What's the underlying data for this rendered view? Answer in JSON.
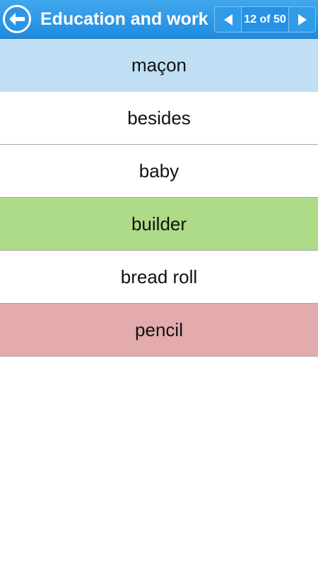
{
  "header": {
    "title": "Education and work",
    "pager_text": "12 of 50",
    "icons": {
      "back": "back-arrow-icon",
      "prev": "left-triangle-icon",
      "next": "right-triangle-icon"
    },
    "colors": {
      "bar": "#2a96e6",
      "text": "#ffffff"
    }
  },
  "answers": [
    {
      "label": "maçon",
      "state": "selected",
      "color": "#c0dff4"
    },
    {
      "label": "besides",
      "state": "normal",
      "color": "#ffffff"
    },
    {
      "label": "baby",
      "state": "normal",
      "color": "#ffffff"
    },
    {
      "label": "builder",
      "state": "correct",
      "color": "#addb88"
    },
    {
      "label": "bread roll",
      "state": "normal",
      "color": "#ffffff"
    },
    {
      "label": "pencil",
      "state": "wrong",
      "color": "#e3abab"
    }
  ]
}
